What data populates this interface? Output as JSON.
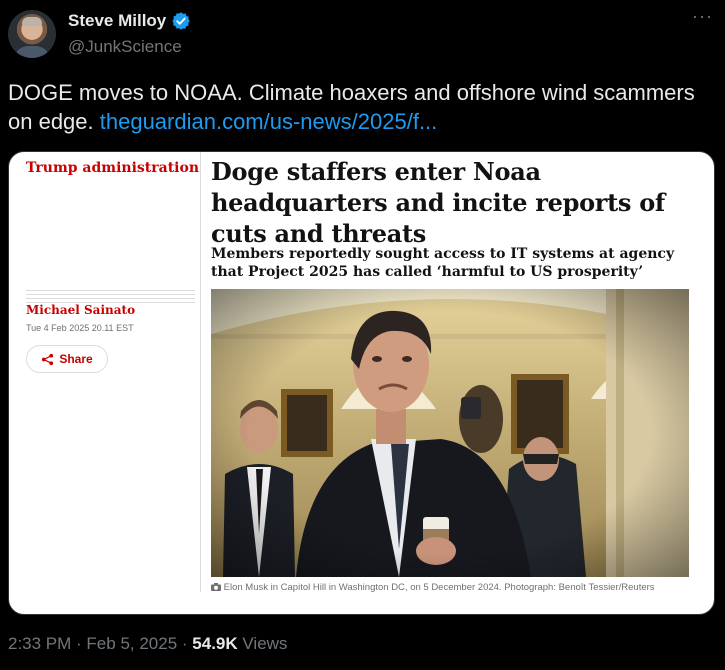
{
  "author": {
    "name": "Steve Milloy",
    "handle": "@JunkScience"
  },
  "menu": {
    "more_label": "···"
  },
  "tweet": {
    "text": "DOGE moves to NOAA. Climate hoaxers and offshore wind scammers on edge. ",
    "link_text": "theguardian.com/us-news/2025/f..."
  },
  "article": {
    "kicker": "Trump administration",
    "headline": "Doge staffers enter Noaa headquarters and incite reports of cuts and threats",
    "standfirst": "Members reportedly sought access to IT systems at agency that Project 2025 has called ‘harmful to US prosperity’",
    "byline": "Michael Sainato",
    "date": "Tue 4 Feb 2025 20.11 EST",
    "share_label": "Share",
    "caption": "Elon Musk in Capitol Hill in Washington DC, on 5 December 2024. Photograph: Benoît Tessier/Reuters"
  },
  "meta": {
    "time": "2:33 PM",
    "sep1": " · ",
    "date": "Feb 5, 2025",
    "sep2": " · ",
    "views": "54.9K",
    "views_label": " Views"
  },
  "colors": {
    "link": "#1d9bf0",
    "guardian_red": "#c70000",
    "verified": "#1d9bf0",
    "muted": "#71767b"
  }
}
